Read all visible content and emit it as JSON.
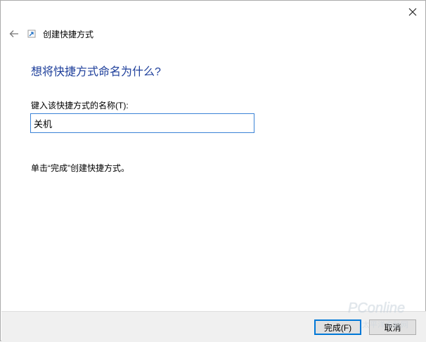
{
  "window": {
    "close_icon": "close-icon",
    "back_icon": "back-arrow-icon"
  },
  "wizard": {
    "title": "创建快捷方式",
    "heading": "想将快捷方式命名为什么?",
    "name_label": "键入该快捷方式的名称(T):",
    "name_value": "关机",
    "hint": "单击“完成”创建快捷方式。"
  },
  "buttons": {
    "finish": "完成(F)",
    "cancel": "取消"
  },
  "watermark": {
    "brand": "PConline",
    "sub": "太平洋电脑网"
  },
  "colors": {
    "heading": "#1e3f9b",
    "input_border": "#3b83d6",
    "footer_bg": "#f0f0f0"
  }
}
